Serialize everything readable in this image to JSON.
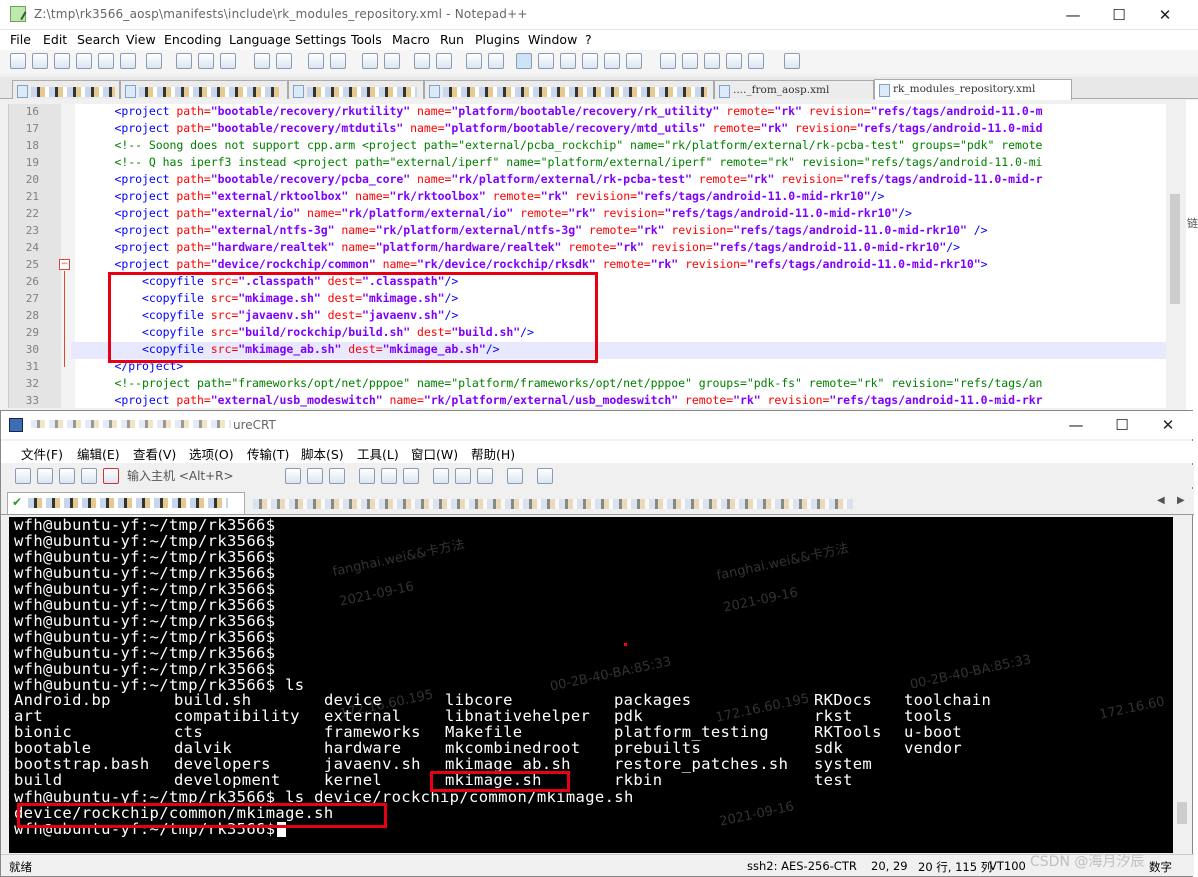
{
  "npp": {
    "title": "Z:\\tmp\\rk3566_aosp\\manifests\\include\\rk_modules_repository.xml - Notepad++",
    "window_controls": {
      "minimize": "—",
      "maximize": "☐",
      "close": "✕"
    },
    "menu": [
      "File",
      "Edit",
      "Search",
      "View",
      "Encoding",
      "Language",
      "Settings",
      "Tools",
      "Macro",
      "Run",
      "Plugins",
      "Window",
      "?"
    ],
    "tabs": [
      {
        "label": "",
        "active": false
      },
      {
        "label": "",
        "active": false
      },
      {
        "label": "",
        "active": false
      },
      {
        "label": "",
        "active": false
      },
      {
        "label": "...._from_aosp.xml",
        "active": false
      },
      {
        "label": "rk_modules_repository.xml",
        "active": true
      }
    ],
    "lines": [
      {
        "n": "16",
        "segments": [
          [
            "    ",
            ""
          ],
          [
            "<project ",
            "t-tag"
          ],
          [
            "path=",
            "t-attr"
          ],
          [
            "\"bootable/recovery/rkutility\"",
            "t-val"
          ],
          [
            " ",
            ""
          ],
          [
            "name=",
            "t-attr"
          ],
          [
            "\"platform/bootable/recovery/rk_utility\"",
            "t-val"
          ],
          [
            " ",
            ""
          ],
          [
            "remote=",
            "t-attr"
          ],
          [
            "\"rk\"",
            "t-val"
          ],
          [
            " ",
            ""
          ],
          [
            "revision=",
            "t-attr"
          ],
          [
            "\"refs/tags/android-11.0-m",
            "t-val"
          ]
        ]
      },
      {
        "n": "17",
        "segments": [
          [
            "    ",
            ""
          ],
          [
            "<project ",
            "t-tag"
          ],
          [
            "path=",
            "t-attr"
          ],
          [
            "\"bootable/recovery/mtdutils\"",
            "t-val"
          ],
          [
            " ",
            ""
          ],
          [
            "name=",
            "t-attr"
          ],
          [
            "\"platform/bootable/recovery/mtd_utils\"",
            "t-val"
          ],
          [
            " ",
            ""
          ],
          [
            "remote=",
            "t-attr"
          ],
          [
            "\"rk\"",
            "t-val"
          ],
          [
            " ",
            ""
          ],
          [
            "revision=",
            "t-attr"
          ],
          [
            "\"refs/tags/android-11.0-mid",
            "t-val"
          ]
        ]
      },
      {
        "n": "18",
        "segments": [
          [
            "    ",
            ""
          ],
          [
            "<!-- Soong does not support cpp.arm <project path=\"external/pcba_rockchip\" name=\"rk/platform/external/rk-pcba-test\" groups=\"pdk\" remote",
            "t-cmt"
          ]
        ]
      },
      {
        "n": "19",
        "segments": [
          [
            "    ",
            ""
          ],
          [
            "<!-- Q has iperf3 instead <project path=\"external/iperf\" name=\"platform/external/iperf\" remote=\"rk\" revision=\"refs/tags/android-11.0-mi",
            "t-cmt"
          ]
        ]
      },
      {
        "n": "20",
        "segments": [
          [
            "    ",
            ""
          ],
          [
            "<project ",
            "t-tag"
          ],
          [
            "path=",
            "t-attr"
          ],
          [
            "\"bootable/recovery/pcba_core\"",
            "t-val"
          ],
          [
            " ",
            ""
          ],
          [
            "name=",
            "t-attr"
          ],
          [
            "\"rk/platform/external/rk-pcba-test\"",
            "t-val"
          ],
          [
            " ",
            ""
          ],
          [
            "remote=",
            "t-attr"
          ],
          [
            "\"rk\"",
            "t-val"
          ],
          [
            " ",
            ""
          ],
          [
            "revision=",
            "t-attr"
          ],
          [
            "\"refs/tags/android-11.0-mid-r",
            "t-val"
          ]
        ]
      },
      {
        "n": "21",
        "segments": [
          [
            "    ",
            ""
          ],
          [
            "<project ",
            "t-tag"
          ],
          [
            "path=",
            "t-attr"
          ],
          [
            "\"external/rktoolbox\"",
            "t-val"
          ],
          [
            " ",
            ""
          ],
          [
            "name=",
            "t-attr"
          ],
          [
            "\"rk/rktoolbox\"",
            "t-val"
          ],
          [
            " ",
            ""
          ],
          [
            "remote=",
            "t-attr"
          ],
          [
            "\"rk\"",
            "t-val"
          ],
          [
            " ",
            ""
          ],
          [
            "revision=",
            "t-attr"
          ],
          [
            "\"refs/tags/android-11.0-mid-rkr10\"",
            "t-val"
          ],
          [
            "/>",
            "t-tag"
          ]
        ]
      },
      {
        "n": "22",
        "segments": [
          [
            "    ",
            ""
          ],
          [
            "<project ",
            "t-tag"
          ],
          [
            "path=",
            "t-attr"
          ],
          [
            "\"external/io\"",
            "t-val"
          ],
          [
            " ",
            ""
          ],
          [
            "name=",
            "t-attr"
          ],
          [
            "\"rk/platform/external/io\"",
            "t-val"
          ],
          [
            " ",
            ""
          ],
          [
            "remote=",
            "t-attr"
          ],
          [
            "\"rk\"",
            "t-val"
          ],
          [
            " ",
            ""
          ],
          [
            "revision=",
            "t-attr"
          ],
          [
            "\"refs/tags/android-11.0-mid-rkr10\"",
            "t-val"
          ],
          [
            "/>",
            "t-tag"
          ]
        ]
      },
      {
        "n": "23",
        "segments": [
          [
            "    ",
            ""
          ],
          [
            "<project ",
            "t-tag"
          ],
          [
            "path=",
            "t-attr"
          ],
          [
            "\"external/ntfs-3g\"",
            "t-val"
          ],
          [
            " ",
            ""
          ],
          [
            "name=",
            "t-attr"
          ],
          [
            "\"rk/platform/external/ntfs-3g\"",
            "t-val"
          ],
          [
            " ",
            ""
          ],
          [
            "remote=",
            "t-attr"
          ],
          [
            "\"rk\"",
            "t-val"
          ],
          [
            " ",
            ""
          ],
          [
            "revision=",
            "t-attr"
          ],
          [
            "\"refs/tags/android-11.0-mid-rkr10\"",
            "t-val"
          ],
          [
            " />",
            "t-tag"
          ]
        ]
      },
      {
        "n": "24",
        "segments": [
          [
            "    ",
            ""
          ],
          [
            "<project ",
            "t-tag"
          ],
          [
            "path=",
            "t-attr"
          ],
          [
            "\"hardware/realtek\"",
            "t-val"
          ],
          [
            " ",
            ""
          ],
          [
            "name=",
            "t-attr"
          ],
          [
            "\"platform/hardware/realtek\"",
            "t-val"
          ],
          [
            " ",
            ""
          ],
          [
            "remote=",
            "t-attr"
          ],
          [
            "\"rk\"",
            "t-val"
          ],
          [
            " ",
            ""
          ],
          [
            "revision=",
            "t-attr"
          ],
          [
            "\"refs/tags/android-11.0-mid-rkr10\"",
            "t-val"
          ],
          [
            "/>",
            "t-tag"
          ]
        ]
      },
      {
        "n": "25",
        "segments": [
          [
            "    ",
            ""
          ],
          [
            "<project ",
            "t-tag"
          ],
          [
            "path=",
            "t-attr"
          ],
          [
            "\"device/rockchip/common\"",
            "t-val"
          ],
          [
            " ",
            ""
          ],
          [
            "name=",
            "t-attr"
          ],
          [
            "\"rk/device/rockchip/rksdk\"",
            "t-val"
          ],
          [
            " ",
            ""
          ],
          [
            "remote=",
            "t-attr"
          ],
          [
            "\"rk\"",
            "t-val"
          ],
          [
            " ",
            ""
          ],
          [
            "revision=",
            "t-attr"
          ],
          [
            "\"refs/tags/android-11.0-mid-rkr10\"",
            "t-val"
          ],
          [
            ">",
            "t-tag"
          ]
        ]
      },
      {
        "n": "26",
        "segments": [
          [
            "        ",
            ""
          ],
          [
            "<copyfile ",
            "t-tag"
          ],
          [
            "src=",
            "t-attr"
          ],
          [
            "\".classpath\"",
            "t-val"
          ],
          [
            " ",
            ""
          ],
          [
            "dest=",
            "t-attr"
          ],
          [
            "\".classpath\"",
            "t-val"
          ],
          [
            "/>",
            "t-tag"
          ]
        ]
      },
      {
        "n": "27",
        "segments": [
          [
            "        ",
            ""
          ],
          [
            "<copyfile ",
            "t-tag"
          ],
          [
            "src=",
            "t-attr"
          ],
          [
            "\"mkimage.sh\"",
            "t-val"
          ],
          [
            " ",
            ""
          ],
          [
            "dest=",
            "t-attr"
          ],
          [
            "\"mkimage.sh\"",
            "t-val"
          ],
          [
            "/>",
            "t-tag"
          ]
        ]
      },
      {
        "n": "28",
        "segments": [
          [
            "        ",
            ""
          ],
          [
            "<copyfile ",
            "t-tag"
          ],
          [
            "src=",
            "t-attr"
          ],
          [
            "\"javaenv.sh\"",
            "t-val"
          ],
          [
            " ",
            ""
          ],
          [
            "dest=",
            "t-attr"
          ],
          [
            "\"javaenv.sh\"",
            "t-val"
          ],
          [
            "/>",
            "t-tag"
          ]
        ]
      },
      {
        "n": "29",
        "segments": [
          [
            "        ",
            ""
          ],
          [
            "<copyfile ",
            "t-tag"
          ],
          [
            "src=",
            "t-attr"
          ],
          [
            "\"build/rockchip/build.sh\"",
            "t-val"
          ],
          [
            " ",
            ""
          ],
          [
            "dest=",
            "t-attr"
          ],
          [
            "\"build.sh\"",
            "t-val"
          ],
          [
            "/>",
            "t-tag"
          ]
        ]
      },
      {
        "n": "30",
        "segments": [
          [
            "        ",
            ""
          ],
          [
            "<copyfile ",
            "t-tag"
          ],
          [
            "src=",
            "t-attr"
          ],
          [
            "\"mkimage_ab.sh\"",
            "t-val"
          ],
          [
            " ",
            ""
          ],
          [
            "dest=",
            "t-attr"
          ],
          [
            "\"mkimage_ab.sh\"",
            "t-val"
          ],
          [
            "/>",
            "t-tag"
          ]
        ]
      },
      {
        "n": "31",
        "segments": [
          [
            "    ",
            ""
          ],
          [
            "</project>",
            "t-tag"
          ]
        ]
      },
      {
        "n": "32",
        "segments": [
          [
            "    ",
            ""
          ],
          [
            "<!--project path=\"frameworks/opt/net/pppoe\" name=\"platform/frameworks/opt/net/pppoe\" groups=\"pdk-fs\" remote=\"rk\" revision=\"refs/tags/an",
            "t-cmt"
          ]
        ]
      },
      {
        "n": "33",
        "segments": [
          [
            "    ",
            ""
          ],
          [
            "<project ",
            "t-tag"
          ],
          [
            "path=",
            "t-attr"
          ],
          [
            "\"external/usb_modeswitch\"",
            "t-val"
          ],
          [
            " ",
            ""
          ],
          [
            "name=",
            "t-attr"
          ],
          [
            "\"rk/platform/external/usb_modeswitch\"",
            "t-val"
          ],
          [
            " ",
            ""
          ],
          [
            "remote=",
            "t-attr"
          ],
          [
            "\"rk\"",
            "t-val"
          ],
          [
            " ",
            ""
          ],
          [
            "revision=",
            "t-attr"
          ],
          [
            "\"refs/tags/android-11.0-mid-rkr",
            "t-val"
          ]
        ]
      }
    ],
    "fold_marker": "⊟"
  },
  "crt": {
    "title": "fh@ubuntu-yf ~/tmp - SecureCRT",
    "title_visible": "ureCRT",
    "window_controls": {
      "minimize": "—",
      "maximize": "☐",
      "close": "✕"
    },
    "menu": [
      "文件(F)",
      "编辑(E)",
      "查看(V)",
      "选项(O)",
      "传输(T)",
      "脚本(S)",
      "工具(L)",
      "窗口(W)",
      "帮助(H)"
    ],
    "quick_connect_placeholder": "输入主机 <Alt+R>",
    "tab_nav": {
      "left": "◀",
      "right": "▶"
    },
    "prompt_lines": [
      "wfh@ubuntu-yf:~/tmp/rk3566$",
      "wfh@ubuntu-yf:~/tmp/rk3566$",
      "wfh@ubuntu-yf:~/tmp/rk3566$",
      "wfh@ubuntu-yf:~/tmp/rk3566$",
      "wfh@ubuntu-yf:~/tmp/rk3566$",
      "wfh@ubuntu-yf:~/tmp/rk3566$",
      "wfh@ubuntu-yf:~/tmp/rk3566$",
      "wfh@ubuntu-yf:~/tmp/rk3566$",
      "wfh@ubuntu-yf:~/tmp/rk3566$",
      "wfh@ubuntu-yf:~/tmp/rk3566$",
      "wfh@ubuntu-yf:~/tmp/rk3566$ ls"
    ],
    "ls_columns": [
      [
        "Android.bp",
        "art",
        "bionic",
        "bootable",
        "bootstrap.bash",
        "build"
      ],
      [
        "build.sh",
        "compatibility",
        "cts",
        "dalvik",
        "developers",
        "development"
      ],
      [
        "device",
        "external",
        "frameworks",
        "hardware",
        "javaenv.sh",
        "kernel"
      ],
      [
        "libcore",
        "libnativehelper",
        "Makefile",
        "mkcombinedroot",
        "mkimage_ab.sh",
        "mkimage.sh"
      ],
      [
        "packages",
        "pdk",
        "platform_testing",
        "prebuilts",
        "restore_patches.sh",
        "rkbin"
      ],
      [
        "RKDocs",
        "rkst",
        "RKTools",
        "sdk",
        "system",
        "test"
      ],
      [
        "toolchain",
        "tools",
        "u-boot",
        "vendor"
      ]
    ],
    "ls2_cmd": "wfh@ubuntu-yf:~/tmp/rk3566$ ls device/rockchip/common/mkimage.sh",
    "ls2_out": "device/rockchip/common/mkimage.sh",
    "final_prompt": "wfh@ubuntu-yf:~/tmp/rk3566$",
    "watermarks": [
      {
        "text": "fanghai.wei&&卡方法"
      },
      {
        "text": "2021-09-16"
      },
      {
        "text": "fanghai.wei&&卡方法"
      },
      {
        "text": "2021-09-16"
      },
      {
        "text": "172.16.60.195"
      },
      {
        "text": "00-2B-40-BA:85:33"
      },
      {
        "text": "172.16.60.195"
      },
      {
        "text": "00-2B-40-BA:85:33"
      },
      {
        "text": "2021-09-16"
      },
      {
        "text": "172.16.60"
      }
    ],
    "status": {
      "ready": "就绪",
      "encryption": "ssh2: AES-256-CTR",
      "cursor": "20, 29",
      "rows_cols": "20 行, 115 列",
      "term": "VT100",
      "caps": "数字"
    }
  },
  "overlay": {
    "csdn_watermark": "CSDN @海月汐辰",
    "side_glyph": "链"
  },
  "colors": {
    "highlight_box": "#e60012",
    "xml_tag": "#0000ff",
    "xml_attr": "#ff0000",
    "xml_value": "#8000ff",
    "xml_comment": "#008000",
    "terminal_bg": "#000000",
    "terminal_fg": "#ffffff"
  }
}
